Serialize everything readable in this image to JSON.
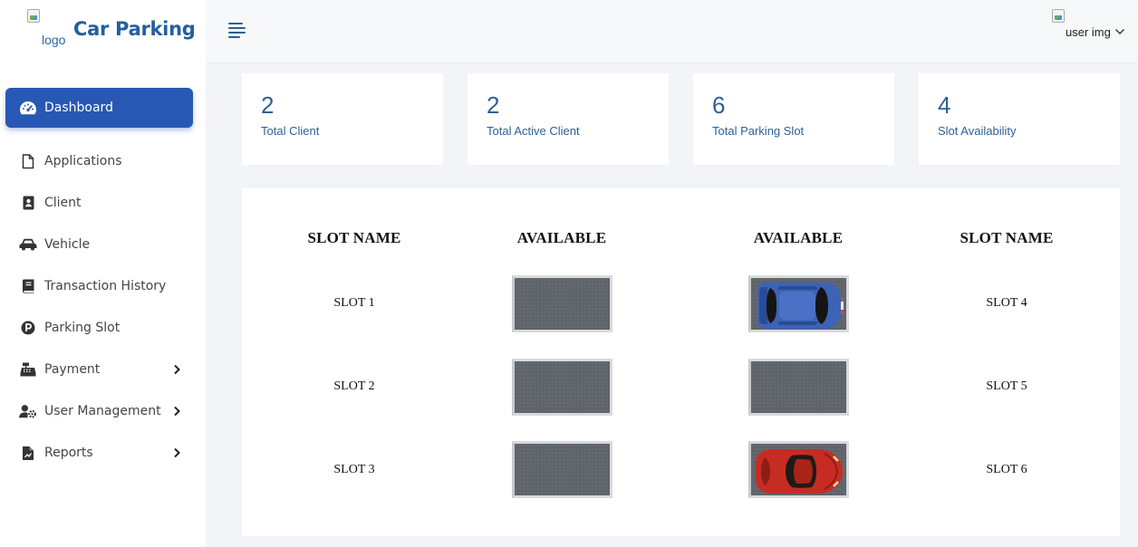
{
  "brand": {
    "logo_alt": "logo",
    "title": "Car Parking"
  },
  "sidebar": {
    "items": [
      {
        "label": "Dashboard",
        "icon": "dashboard-gauge-icon",
        "active": true
      },
      {
        "label": "Applications",
        "icon": "file-icon"
      },
      {
        "label": "Client",
        "icon": "contact-card-icon"
      },
      {
        "label": "Vehicle",
        "icon": "car-icon"
      },
      {
        "label": "Transaction History",
        "icon": "book-icon"
      },
      {
        "label": "Parking Slot",
        "icon": "parking-p-icon"
      },
      {
        "label": "Payment",
        "icon": "cash-register-icon",
        "submenu": true
      },
      {
        "label": "User Management",
        "icon": "user-cog-icon",
        "submenu": true
      },
      {
        "label": "Reports",
        "icon": "report-file-icon",
        "submenu": true
      }
    ]
  },
  "header": {
    "user_img_alt": "user img"
  },
  "stats": [
    {
      "value": "2",
      "label": "Total Client"
    },
    {
      "value": "2",
      "label": "Total Active Client"
    },
    {
      "value": "6",
      "label": "Total Parking Slot"
    },
    {
      "value": "4",
      "label": "Slot Availability"
    }
  ],
  "parking": {
    "headers": [
      "SLOT NAME",
      "AVAILABLE",
      "AVAILABLE",
      "SLOT NAME"
    ],
    "left_slots": [
      "SLOT 1",
      "SLOT 2",
      "SLOT 3"
    ],
    "right_slots": [
      "SLOT 4",
      "SLOT 5",
      "SLOT 6"
    ],
    "left_spaces": [
      "empty",
      "empty",
      "empty"
    ],
    "right_spaces": [
      "occupied-blue",
      "empty",
      "occupied-red"
    ]
  },
  "colors": {
    "accent": "#2758b4",
    "stat_text": "#2d5f98",
    "panel_bg": "#ffffff",
    "page_bg": "#f2f4f8"
  }
}
